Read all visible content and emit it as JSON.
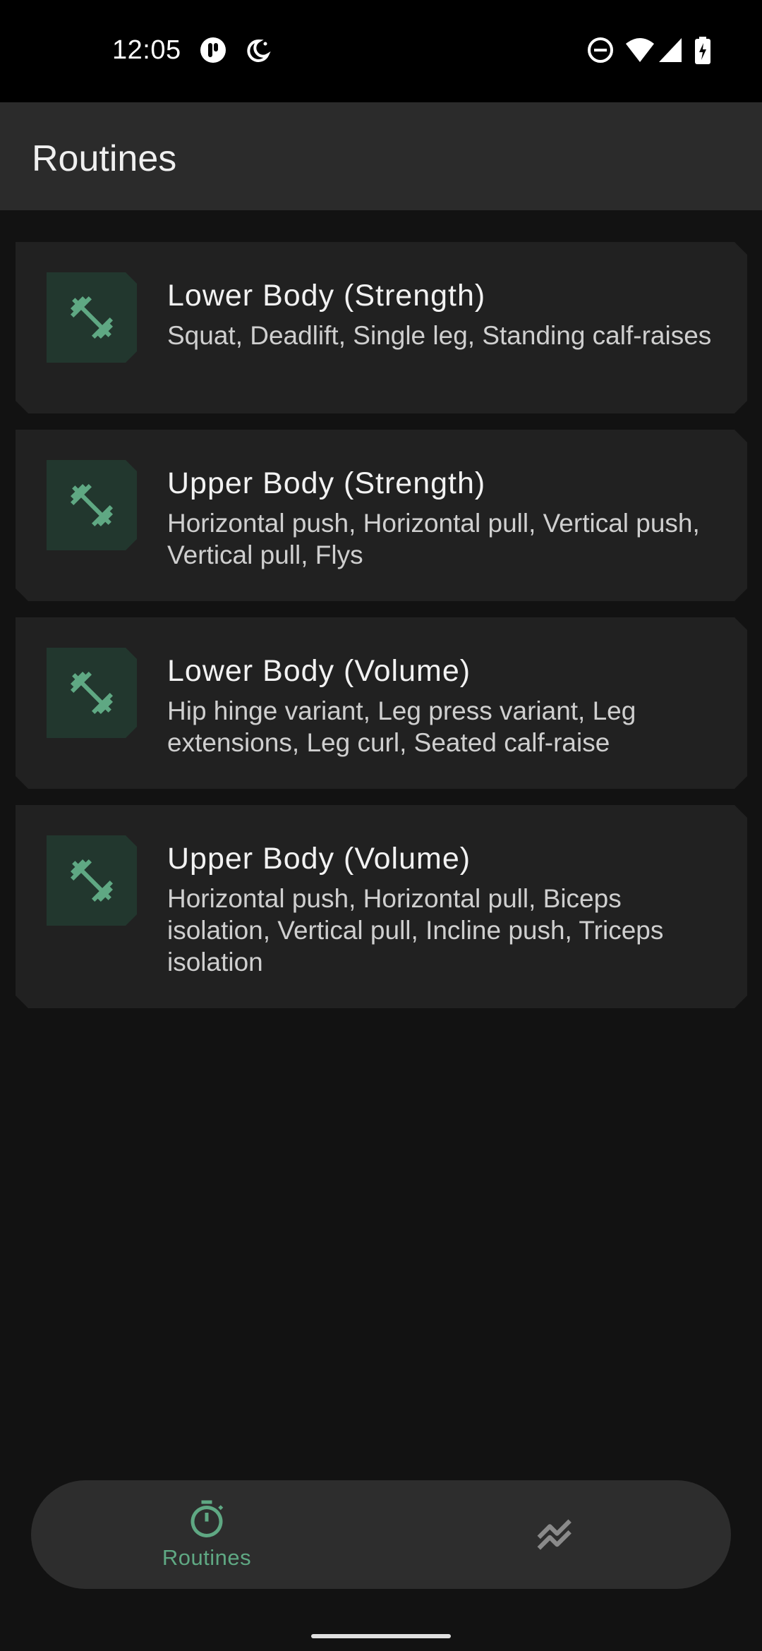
{
  "status_bar": {
    "time": "12:05",
    "icons": [
      "notification-icon",
      "do-not-disturb-moon-icon",
      "dnd-icon",
      "wifi-icon",
      "cell-signal-icon",
      "battery-icon"
    ]
  },
  "app_bar": {
    "title": "Routines"
  },
  "routines": [
    {
      "title": "Lower Body (Strength)",
      "description": "Squat, Deadlift, Single leg, Standing calf-raises",
      "icon": "dumbbell-icon"
    },
    {
      "title": "Upper Body (Strength)",
      "description": "Horizontal push, Horizontal pull, Vertical push, Vertical pull, Flys",
      "icon": "dumbbell-icon"
    },
    {
      "title": "Lower Body (Volume)",
      "description": "Hip hinge variant, Leg press variant, Leg extensions, Leg curl, Seated calf-raise",
      "icon": "dumbbell-icon"
    },
    {
      "title": "Upper Body (Volume)",
      "description": "Horizontal push, Horizontal pull, Biceps isolation, Vertical pull, Incline push, Triceps isolation",
      "icon": "dumbbell-icon"
    }
  ],
  "bottom_nav": {
    "routines_label": "Routines",
    "routines_icon": "timer-icon",
    "progress_icon": "chart-icon"
  },
  "colors": {
    "accent": "#5fa883",
    "icon_box": "#22372e",
    "card": "#212121",
    "background": "#121212"
  }
}
